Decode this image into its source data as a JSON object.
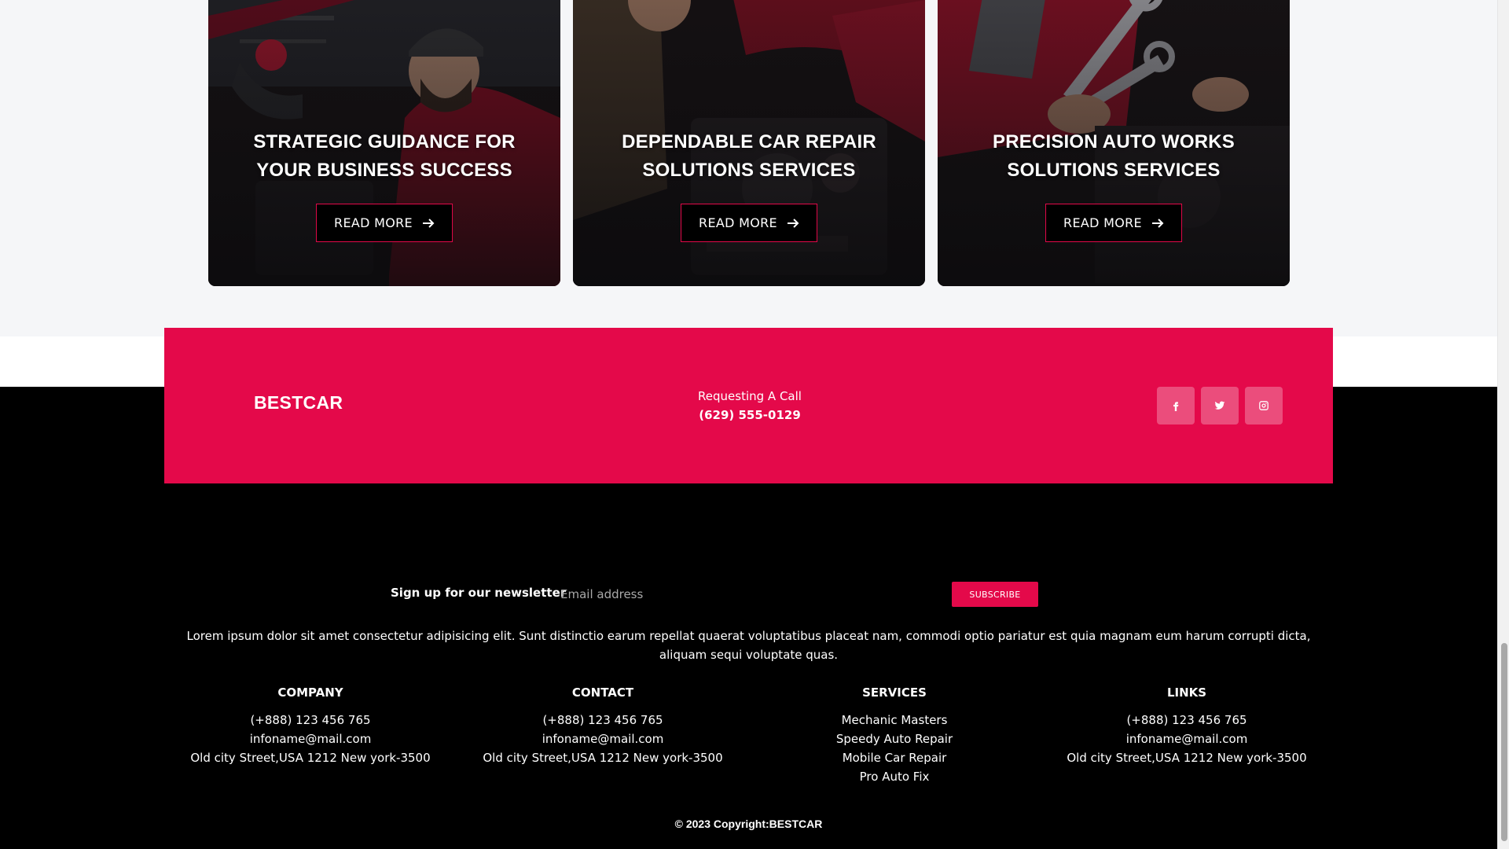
{
  "service_cards": [
    {
      "title": "Strategic Guidance For Your Business Success",
      "button_label": "READ MORE"
    },
    {
      "title": "Dependable Car Repair Solutions Services",
      "button_label": "READ MORE"
    },
    {
      "title": "Precision Auto Works Solutions Services",
      "button_label": "READ MORE"
    }
  ],
  "cta": {
    "brand": "BESTCAR",
    "call_label": "Requesting A Call",
    "call_phone": "(629) 555-0129",
    "social_icons": [
      "facebook-icon",
      "twitter-icon",
      "instagram-icon"
    ]
  },
  "newsletter": {
    "label": "Sign up for our newsletter",
    "placeholder": "Email address",
    "button_label": "SUBSCRIBE"
  },
  "description": "Lorem ipsum dolor sit amet consectetur adipisicing elit. Sunt distinctio earum repellat quaerat voluptatibus placeat nam, commodi optio pariatur est quia magnam eum harum corrupti dicta, aliquam sequi voluptate quas.",
  "footer_columns": [
    {
      "heading": "COMPANY",
      "lines": [
        "(+888) 123 456 765",
        "infoname@mail.com",
        "Old city Street,USA 1212 New york-3500"
      ]
    },
    {
      "heading": "CONTACT",
      "lines": [
        "(+888) 123 456 765",
        "infoname@mail.com",
        "Old city Street,USA 1212 New york-3500"
      ]
    },
    {
      "heading": "SERVICES",
      "lines": [
        "Mechanic Masters",
        "Speedy Auto Repair",
        "Mobile Car Repair",
        "Pro Auto Fix"
      ]
    },
    {
      "heading": "LINKS",
      "lines": [
        "(+888) 123 456 765",
        "infoname@mail.com",
        "Old city Street,USA 1212 New york-3500"
      ]
    }
  ],
  "copyright": "© 2023 Copyright:BESTCAR",
  "colors": {
    "accent": "#e4094a",
    "footer_bg": "#000000",
    "page_bg": "#f5f6f8"
  }
}
